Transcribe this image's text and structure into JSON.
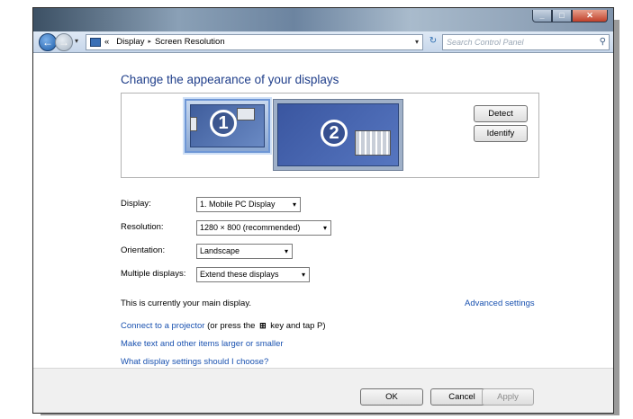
{
  "window": {
    "controls": {
      "minimize": "_",
      "maximize": "□",
      "close": "✕"
    }
  },
  "address_bar": {
    "back_icon": "←",
    "forward_icon": "→",
    "dropdown_icon": "▾",
    "overflow": "«",
    "crumbs": [
      "Display",
      "Screen Resolution"
    ],
    "crumb_separator": "▸",
    "refresh_icon": "↻",
    "search_placeholder": "Search Control Panel",
    "search_icon": "⚲"
  },
  "main": {
    "heading": "Change the appearance of your displays",
    "monitors": [
      {
        "number": "1",
        "selected": true
      },
      {
        "number": "2",
        "selected": false
      }
    ],
    "detect_button": "Detect",
    "identify_button": "Identify",
    "settings": [
      {
        "label": "Display:",
        "value": "1. Mobile PC Display"
      },
      {
        "label": "Resolution:",
        "value": "1280 × 800 (recommended)"
      },
      {
        "label": "Orientation:",
        "value": "Landscape"
      },
      {
        "label": "Multiple displays:",
        "value": "Extend these displays"
      }
    ],
    "dropdown_caret": "▾",
    "status_text": "This is currently your main display.",
    "advanced_link": "Advanced settings",
    "projector_link": "Connect to a projector",
    "projector_suffix": "(or press the",
    "projector_key": "⊞",
    "projector_suffix2": "key and tap P)",
    "larger_link": "Make text and other items larger or smaller",
    "help_link": "What display settings should I choose?"
  },
  "footer": {
    "ok": "OK",
    "cancel": "Cancel",
    "apply": "Apply"
  },
  "colors": {
    "heading": "#1f3e8a",
    "link": "#1a52b0",
    "monitor_fill": "#4a68b0"
  }
}
